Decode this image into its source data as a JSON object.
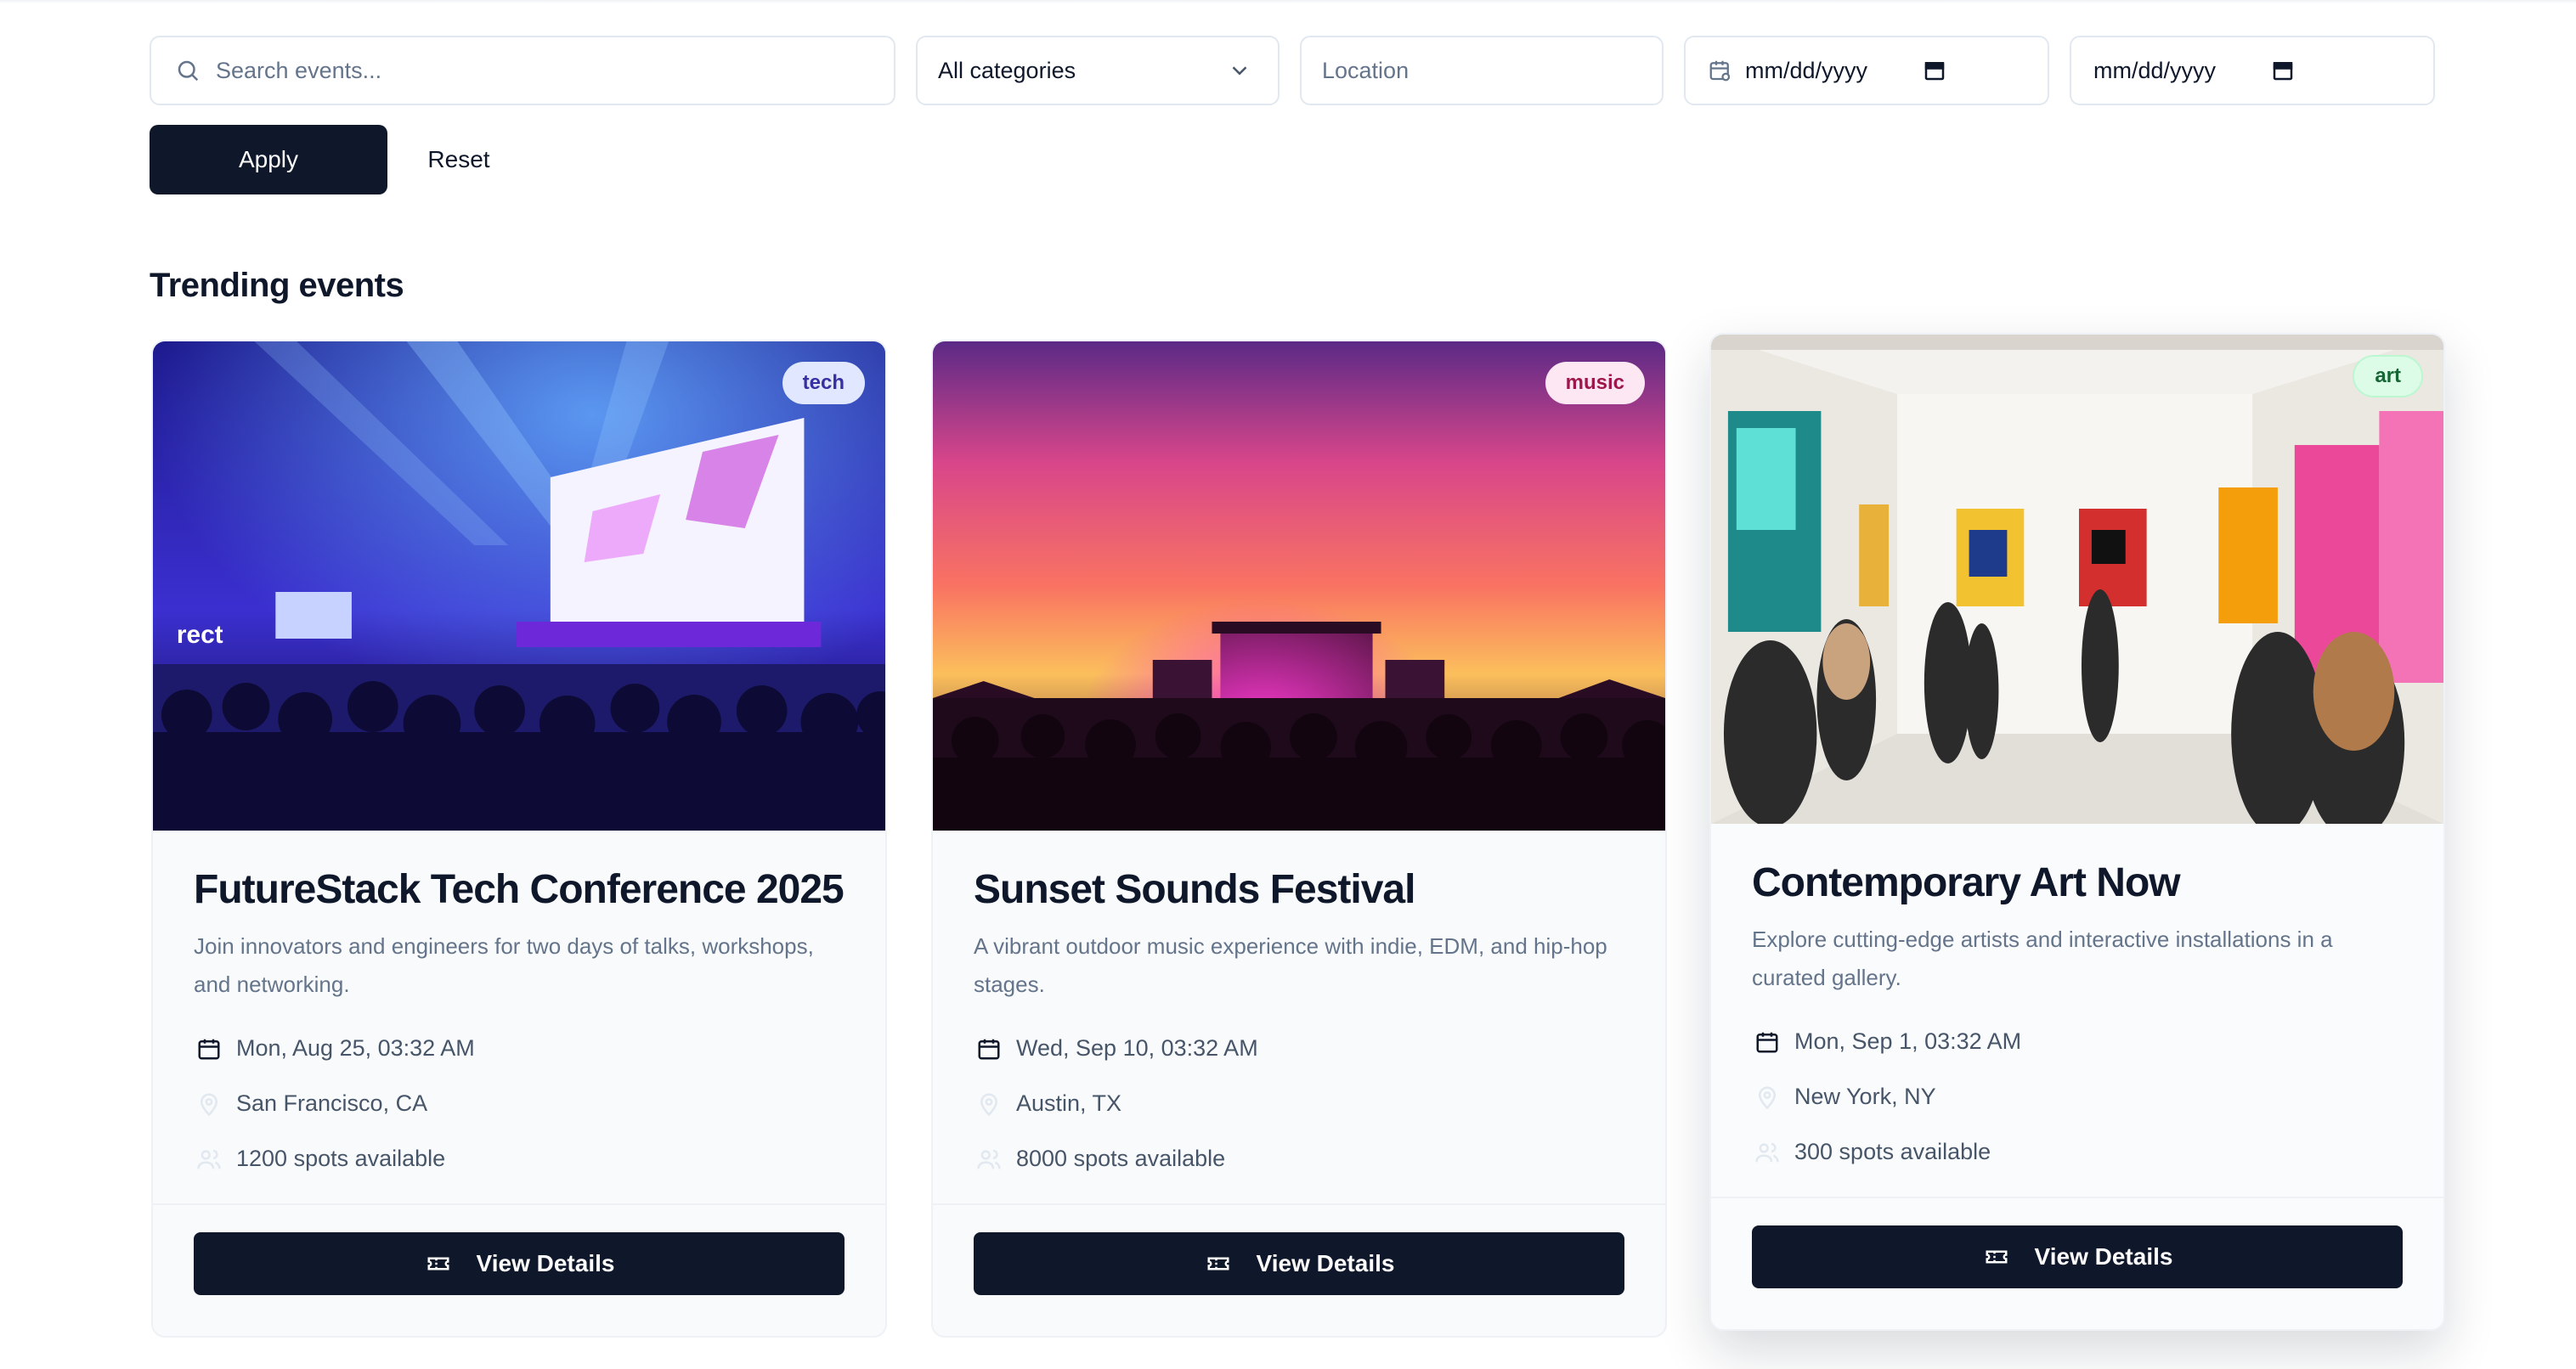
{
  "filters": {
    "search_placeholder": "Search events...",
    "category_value": "All categories",
    "location_placeholder": "Location",
    "date_from": "mm/dd/yyyy",
    "date_to": "mm/dd/yyyy",
    "apply_label": "Apply",
    "reset_label": "Reset"
  },
  "section": {
    "title": "Trending events"
  },
  "events": [
    {
      "badge": "tech",
      "title": "FutureStack Tech Conference 2025",
      "description": "Join innovators and engineers for two days of talks, workshops, and networking.",
      "datetime": "Mon, Aug 25, 03:32 AM",
      "location": "San Francisco, CA",
      "spots": "1200 spots available",
      "button": "View Details"
    },
    {
      "badge": "music",
      "title": "Sunset Sounds Festival",
      "description": "A vibrant outdoor music experience with indie, EDM, and hip-hop stages.",
      "datetime": "Wed, Sep 10, 03:32 AM",
      "location": "Austin, TX",
      "spots": "8000 spots available",
      "button": "View Details"
    },
    {
      "badge": "art",
      "title": "Contemporary Art Now",
      "description": "Explore cutting-edge artists and interactive installations in a curated gallery.",
      "datetime": "Mon, Sep 1, 03:32 AM",
      "location": "New York, NY",
      "spots": "300 spots available",
      "button": "View Details"
    }
  ],
  "colors": {
    "primary": "#0f172a",
    "muted_text": "#64748b",
    "border": "#e2e8f0"
  },
  "icons": [
    "search-icon",
    "chevron-down-icon",
    "calendar-icon",
    "map-pin-icon",
    "users-icon",
    "ticket-icon"
  ]
}
